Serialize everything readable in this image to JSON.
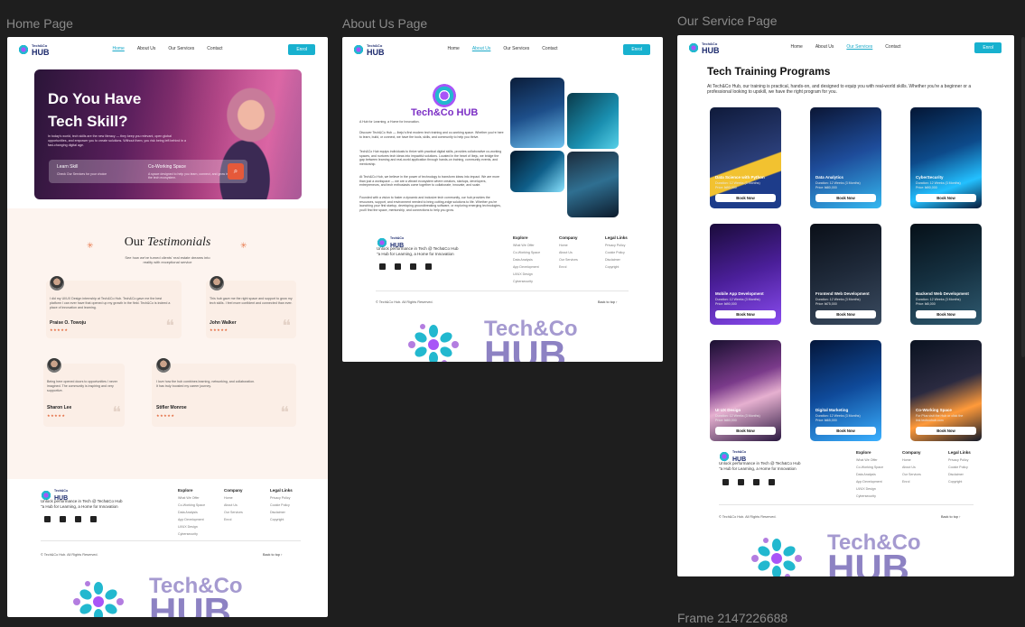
{
  "frames": {
    "home": {
      "label": "Home Page"
    },
    "about": {
      "label": "About Us Page"
    },
    "service": {
      "label": "Our Service Page"
    },
    "extra": {
      "label": "Frame 2147226688"
    }
  },
  "nav": {
    "logo_small": "Tech&Co",
    "logo_big": "HUB",
    "links": [
      "Home",
      "About Us",
      "Our Services",
      "Contact"
    ],
    "enrol": "Enrol"
  },
  "home": {
    "hero_title_1": "Do You Have",
    "hero_title_2": "Tech Skill?",
    "hero_text": "In today's world, tech skills are the new literacy — they keep you relevant, open global opportunities, and empower you to create solutions. Without them, you risk being left behind in a fast-changing digital age.",
    "search": {
      "learn_label": "Learn Skill",
      "learn_sub": "Check Our Services for your choice",
      "cowork_label": "Co-Working Space",
      "cowork_sub": "A space designed to help you learn, connect, and grow in the tech ecosystem.",
      "btn_icon": "search-icon"
    },
    "testimonials": {
      "title_plain": "Our",
      "title_italic": "Testimonials",
      "subtitle": "See how we've turned clients' real estate dreams into reality with exceptional service",
      "items": [
        {
          "text": "I did my UI/UX Design internship at Tech&Co Hub. Tech&Co gave me the best platform I can ever have that opened up my growth in the field. Tech&Co is indeed a place of innovation and learning.",
          "name": "Praise O. Towoju",
          "stars": "★★★★★"
        },
        {
          "text": "This hub gave me the right space and support to grow my tech skills. I feel more confident and connected than ever.",
          "name": "John Walker",
          "stars": "★★★★★"
        },
        {
          "text": "Being here opened doors to opportunities I never imagined. The community is inspiring and very supportive.",
          "name": "Sharon Lee",
          "stars": "★★★★★"
        },
        {
          "text": "I love how the hub combines learning, networking, and collaboration. It has truly boosted my career journey.",
          "name": "Stifler Monroe",
          "stars": "★★★★★"
        }
      ]
    }
  },
  "footer": {
    "tagline_1": "Unlock performance in Tech @ Tech&Co Hub",
    "tagline_2": "\"a Hub for Learning, a Home for Innovation",
    "explore_title": "Explore",
    "explore": [
      "What We Offer",
      "Co-Working Space",
      "Data Analysis",
      "App Development",
      "UI/UX Design",
      "Cybersecurity"
    ],
    "company_title": "Company",
    "company": [
      "Home",
      "About Us",
      "Our Services",
      "Enrol"
    ],
    "legal_title": "Legal Links",
    "legal": [
      "Privacy Policy",
      "Cookie Policy",
      "Disclaimer",
      "Copyright"
    ],
    "copyright": "© Tech&Co Hub. All Rights Reserved.",
    "back_to_top": "Back to top ↑"
  },
  "about": {
    "logo_name": "Tech&Co HUB",
    "p1": "A Hub for Learning, a Home for Innovation.",
    "p2": "Discover Tech&Co Hub — Ibeju's first modern tech training and co-working space. Whether you're here to learn, build, or connect, we have the tools, skills, and community to help you thrive.",
    "p3": "Tech&Co Hub equips individuals to thrive with practical digital skills, provides collaborative co-working spaces, and nurtures tech ideas into impactful solutions. Located in the heart of Ibeju, we bridge the gap between learning and real-world application through hands-on training, community events, and mentorship.",
    "p4": "At Tech&Co Hub, we believe in the power of technology to transform ideas into impact. We are more than just a workspace — we are a vibrant ecosystem where creators, startups, developers, entrepreneurs, and tech enthusiasts come together to collaborate, innovate, and scale.",
    "p5": "Founded with a vision to foster a dynamic and inclusive tech community, our hub provides the resources, support, and environment needed to bring cutting-edge solutions to life. Whether you're launching your first startup, developing groundbreaking software, or exploring emerging technologies, you'll find the space, mentorship, and connections to help you grow."
  },
  "service": {
    "title": "Tech Training Programs",
    "intro": "At Tech&Co Hub, our training is practical, hands-on, and designed to equip you with real-world skills. Whether you're a beginner or a professional looking to upskill, we have the right program for you.",
    "cards": [
      {
        "title": "Data Science with Python",
        "meta1": "Duration: 12 Weeks (3 Months)",
        "meta2": "Price: ₦90,000",
        "btn": "Book Now"
      },
      {
        "title": "Data Analytics",
        "meta1": "Duration: 12 Weeks (3 Months)",
        "meta2": "Price: ₦80,000",
        "btn": "Book Now"
      },
      {
        "title": "CyberSecurity",
        "meta1": "Duration: 12 Weeks (3 Months)",
        "meta2": "Price: ₦90,000",
        "btn": "Book Now"
      },
      {
        "title": "Mobile App Development",
        "meta1": "Duration: 12 Weeks (3 Months)",
        "meta2": "Price: ₦90,000",
        "btn": "Book Now"
      },
      {
        "title": "Frontend Web Development",
        "meta1": "Duration: 12 Weeks (3 Months)",
        "meta2": "Price: ₦75,000",
        "btn": "Book Now"
      },
      {
        "title": "Backend Web Development",
        "meta1": "Duration: 12 Weeks (3 Months)",
        "meta2": "Price: ₦5,000",
        "btn": "Book Now"
      },
      {
        "title": "UI UX Design",
        "meta1": "Duration: 12 Weeks (3 Months)",
        "meta2": "Price: ₦80,000",
        "btn": "Book Now"
      },
      {
        "title": "Digital Marketing",
        "meta1": "Duration: 12 Weeks (3 Months)",
        "meta2": "Price: ₦65,000",
        "btn": "Book Now"
      },
      {
        "title": "Co-Working Space",
        "meta1": "For Plus visit the Hub or click the",
        "meta2": "link techcohub.com",
        "btn": "Book Now"
      }
    ]
  },
  "wordmark": {
    "small": "Tech&Co",
    "big": "HUB"
  },
  "colors": {
    "accent": "#18b1cf",
    "canvas": "#1e1e1e",
    "brand_purple": "#8d82c3",
    "orange": "#e5593a"
  }
}
